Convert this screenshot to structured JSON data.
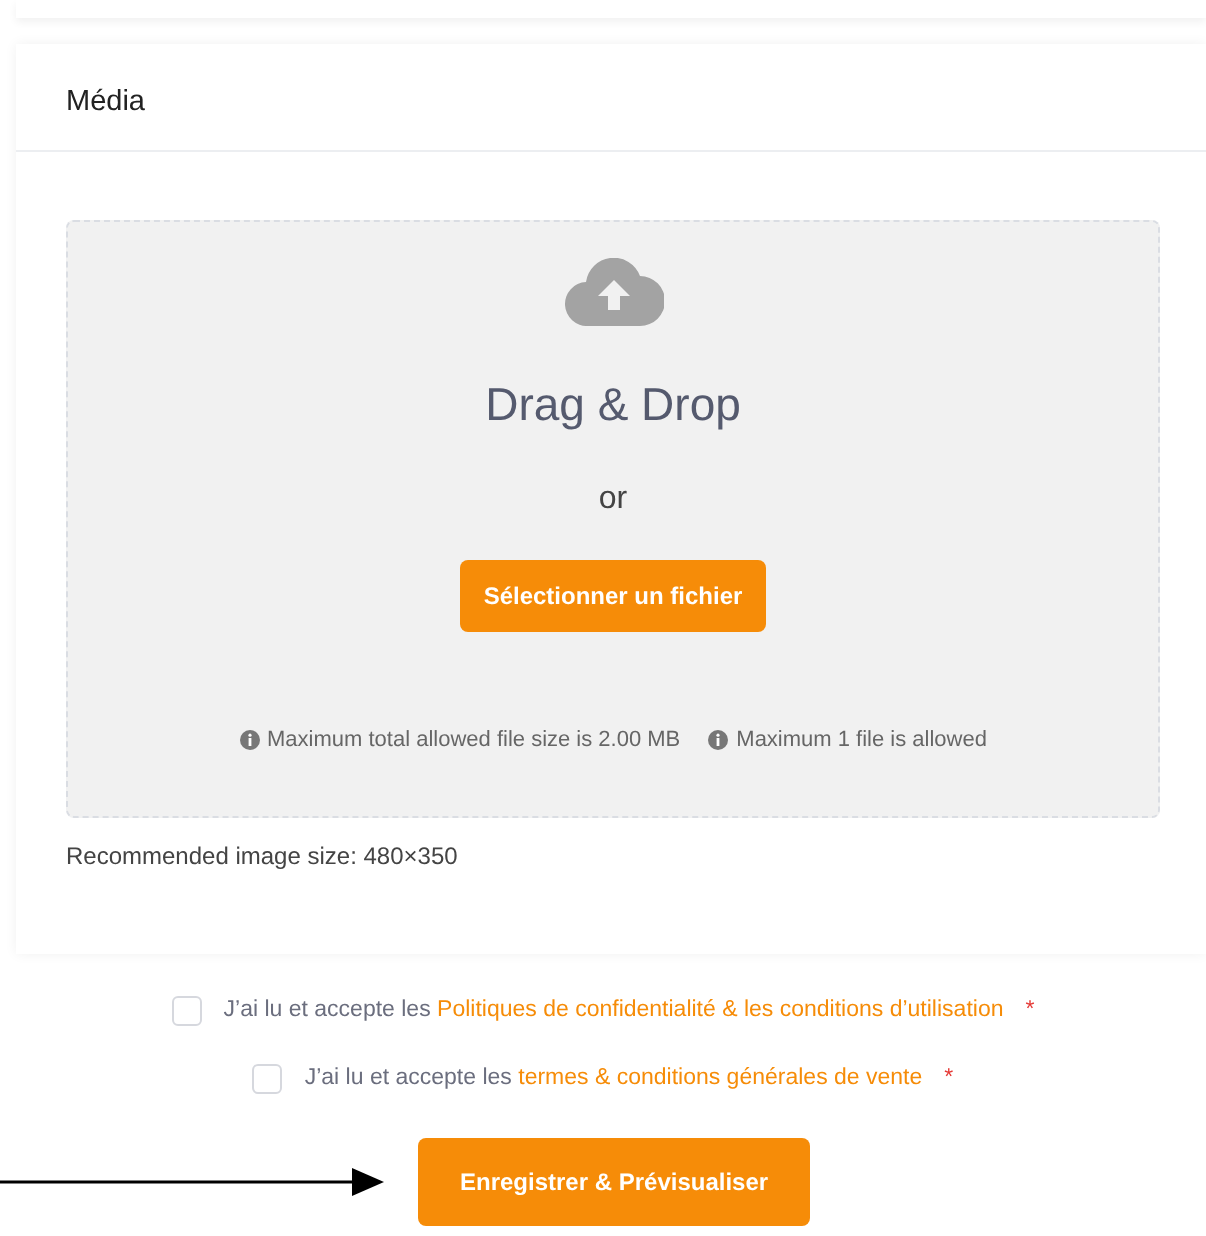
{
  "card": {
    "title": "Média"
  },
  "dropzone": {
    "title": "Drag & Drop",
    "separator": "or",
    "button": "Sélectionner un fichier",
    "notes": [
      "Maximum total allowed file size is 2.00 MB",
      "Maximum 1 file is allowed"
    ]
  },
  "hint": "Recommended image size: 480×350",
  "consents": [
    {
      "text": "J’ai lu et accepte les ",
      "link": "Politiques de confidentialité & les conditions d’utilisation",
      "required": "*",
      "checked": false
    },
    {
      "text": "J’ai lu et accepte les ",
      "link": "termes & conditions générales de vente",
      "required": "*",
      "checked": false
    }
  ],
  "submit": "Enregistrer & Prévisualiser"
}
